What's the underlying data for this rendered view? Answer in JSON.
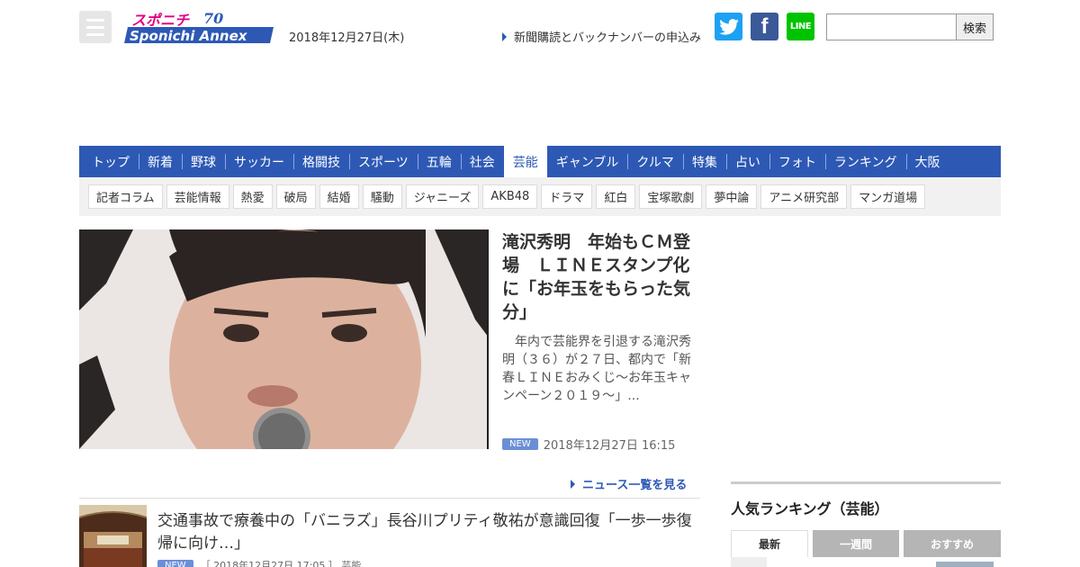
{
  "header": {
    "logo_text": "Sponichi Annex",
    "logo_kana": "スポニチ",
    "logo_anniv": "70",
    "date": "2018年12月27日(木)",
    "subscribe_link": "新聞購読とバックナンバーの申込み",
    "search_button": "検索",
    "search_value": "",
    "sns": {
      "facebook": "f",
      "line": "LINE"
    }
  },
  "nav": {
    "items": [
      "トップ",
      "新着",
      "野球",
      "サッカー",
      "格闘技",
      "スポーツ",
      "五輪",
      "社会",
      "芸能",
      "ギャンブル",
      "クルマ",
      "特集",
      "占い",
      "フォト",
      "ランキング",
      "大阪"
    ],
    "active": "芸能"
  },
  "subnav": {
    "tags": [
      "記者コラム",
      "芸能情報",
      "熱愛",
      "破局",
      "結婚",
      "騒動",
      "ジャニーズ",
      "AKB48",
      "ドラマ",
      "紅白",
      "宝塚歌劇",
      "夢中論",
      "アニメ研究部",
      "マンガ道場"
    ]
  },
  "hero": {
    "title": "滝沢秀明　年始もＣＭ登場　ＬＩＮＥスタンプ化に「お年玉をもらった気分」",
    "summary": "　年内で芸能界を引退する滝沢秀明（３６）が２７日、都内で「新春ＬＩＮＥおみくじ〜お年玉キャンペーン２０１９〜」...",
    "badge": "NEW",
    "timestamp": "2018年12月27日 16:15"
  },
  "news_more": "ニュース一覧を見る",
  "news_items": [
    {
      "title": "交通事故で療養中の「バニラズ」長谷川プリティ敬祐が意識回復「一歩一歩復帰に向け…」",
      "badge": "NEW",
      "meta": "［ 2018年12月27日 17:05 ］ 芸能"
    }
  ],
  "sidebar": {
    "ranking_title": "人気ランキング（芸能）",
    "tabs": [
      "最新",
      "一週間",
      "おすすめ"
    ]
  },
  "colors": {
    "nav_blue": "#2d59b5",
    "twitter": "#1da1f2",
    "facebook": "#3b5998",
    "line": "#00c300",
    "badge_new": "#6b8fd6"
  }
}
